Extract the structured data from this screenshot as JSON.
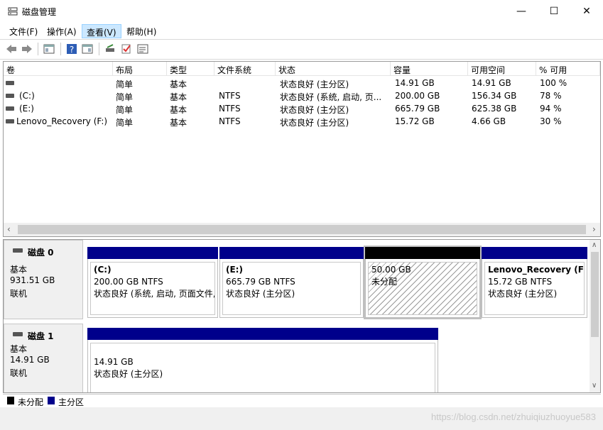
{
  "window": {
    "title": "磁盘管理",
    "min": "—",
    "max": "☐",
    "close": "✕"
  },
  "menu": [
    {
      "label": "文件(F)"
    },
    {
      "label": "操作(A)"
    },
    {
      "label": "查看(V)"
    },
    {
      "label": "帮助(H)"
    }
  ],
  "volume_table": {
    "headers": [
      "卷",
      "布局",
      "类型",
      "文件系统",
      "状态",
      "容量",
      "可用空间",
      "% 可用"
    ],
    "rows": [
      [
        "",
        "简单",
        "基本",
        "",
        "状态良好 (主分区)",
        "14.91 GB",
        "14.91 GB",
        "100 %"
      ],
      [
        "(C:)",
        "简单",
        "基本",
        "NTFS",
        "状态良好 (系统, 启动, 页...",
        "200.00 GB",
        "156.34 GB",
        "78 %"
      ],
      [
        "(E:)",
        "简单",
        "基本",
        "NTFS",
        "状态良好 (主分区)",
        "665.79 GB",
        "625.38 GB",
        "94 %"
      ],
      [
        "Lenovo_Recovery (F:)",
        "简单",
        "基本",
        "NTFS",
        "状态良好 (主分区)",
        "15.72 GB",
        "4.66 GB",
        "30 %"
      ]
    ]
  },
  "disks": [
    {
      "name": "磁盘 0",
      "type": "基本",
      "size": "931.51 GB",
      "status": "联机",
      "partitions": [
        {
          "name": "(C:)",
          "size": "200.00 GB NTFS",
          "status": "状态良好 (系统, 启动, 页面文件,"
        },
        {
          "name": "(E:)",
          "size": "665.79 GB NTFS",
          "status": "状态良好 (主分区)"
        },
        {
          "name": "",
          "size": "50.00 GB",
          "status": "未分配"
        },
        {
          "name": "Lenovo_Recovery  (F:)",
          "size": "15.72 GB NTFS",
          "status": "状态良好 (主分区)"
        }
      ]
    },
    {
      "name": "磁盘 1",
      "type": "基本",
      "size": "14.91 GB",
      "status": "联机",
      "partitions": [
        {
          "name": "",
          "size": "14.91 GB",
          "status": "状态良好 (主分区)"
        }
      ]
    }
  ],
  "legend": {
    "unallocated": "未分配",
    "primary": "主分区"
  },
  "colors": {
    "primary": "#00008b",
    "unallocated": "#000000"
  },
  "watermark": "https://blog.csdn.net/zhuiqiuzhuoyue583"
}
